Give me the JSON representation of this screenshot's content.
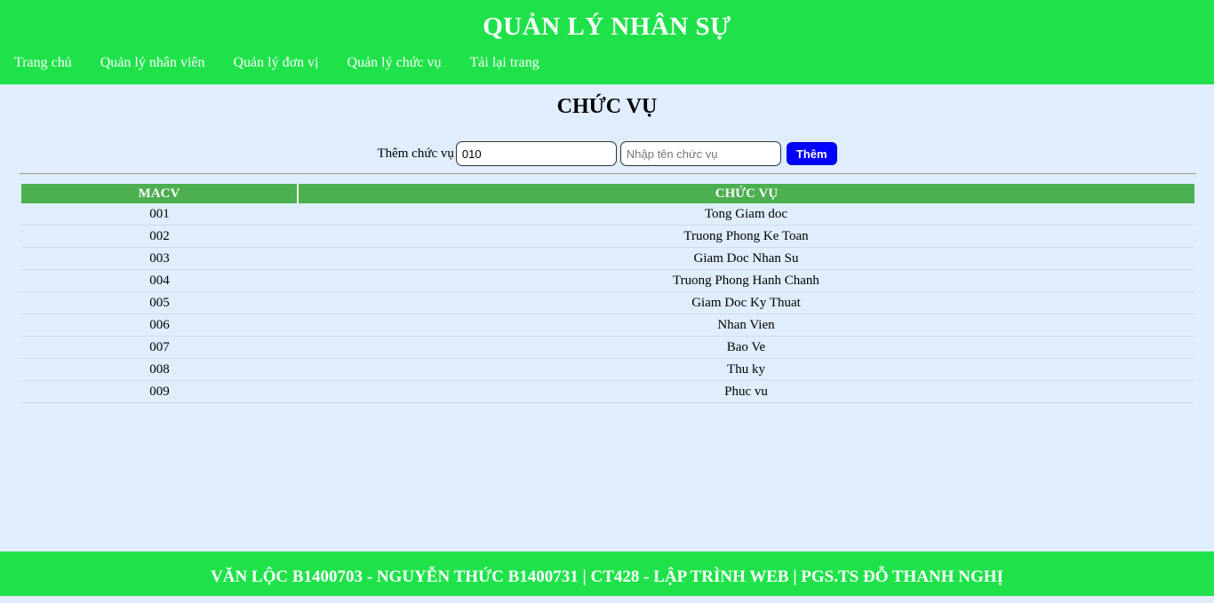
{
  "header": {
    "title": "QUẢN LÝ NHÂN SỰ",
    "nav": [
      {
        "label": "Trang chủ"
      },
      {
        "label": "Quản lý nhân viên"
      },
      {
        "label": "Quản lý đơn vị"
      },
      {
        "label": "Quản lý chức vụ"
      },
      {
        "label": "Tải lại trang"
      }
    ]
  },
  "main": {
    "title": "CHỨC VỤ",
    "form": {
      "label": "Thêm chức vụ",
      "code_value": "010",
      "name_placeholder": "Nhập tên chức vụ",
      "button_label": "Thêm"
    },
    "table": {
      "columns": [
        "MACV",
        "CHỨC VỤ"
      ],
      "rows": [
        [
          "001",
          "Tong Giam doc"
        ],
        [
          "002",
          "Truong Phong Ke Toan"
        ],
        [
          "003",
          "Giam Doc Nhan Su"
        ],
        [
          "004",
          "Truong Phong Hanh Chanh"
        ],
        [
          "005",
          "Giam Doc Ky Thuat"
        ],
        [
          "006",
          "Nhan Vien"
        ],
        [
          "007",
          "Bao Ve"
        ],
        [
          "008",
          "Thu ky"
        ],
        [
          "009",
          "Phuc vu"
        ]
      ]
    }
  },
  "footer": {
    "text": "VĂN LỘC B1400703 - NGUYỄN THỨC B1400731 | CT428 - LẬP TRÌNH WEB | PGS.TS ĐỖ THANH NGHỊ"
  },
  "colors": {
    "header_bg": "#1fe24a",
    "page_bg": "#dfedfc",
    "table_header_bg": "#4caf50",
    "button_bg": "#0000ff"
  }
}
